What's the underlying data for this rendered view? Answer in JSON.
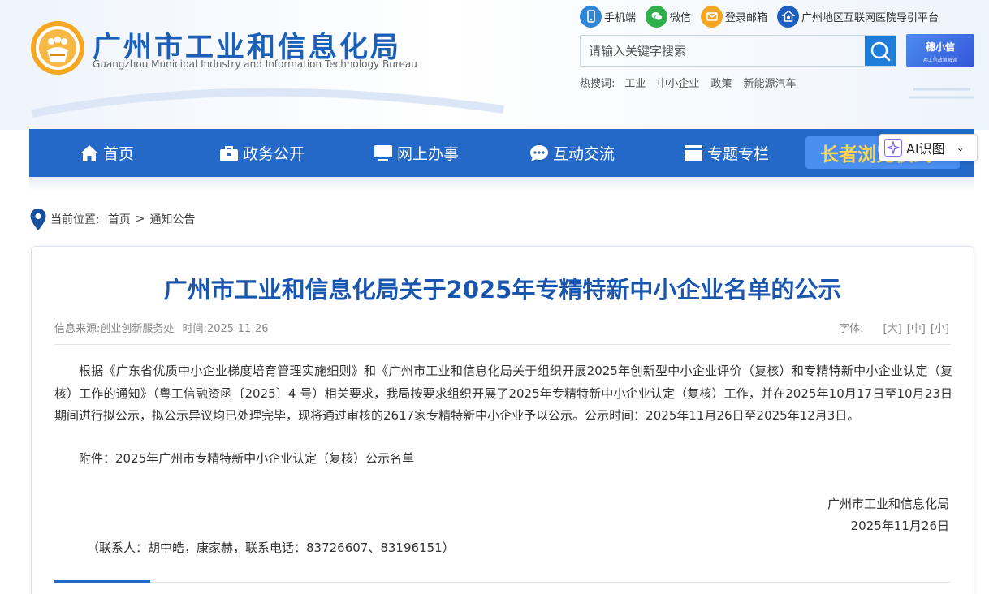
{
  "header": {
    "site_name_cn": "广州市工业和信息化局",
    "site_name_en": "Guangzhou Municipal Industry and Information Technology Bureau",
    "top_links": [
      {
        "label": "手机端",
        "icon": "mobile-icon"
      },
      {
        "label": "微信",
        "icon": "wechat-icon"
      },
      {
        "label": "登录邮箱",
        "icon": "mail-icon"
      },
      {
        "label": "广州地区互联网医院导引平台",
        "icon": "hospital-icon"
      }
    ],
    "search_placeholder": "请输入关键字搜索",
    "ai_banner_title": "穗小信",
    "ai_banner_sub": "AI工信政策解读",
    "hot_label": "热搜词:",
    "hot_words": [
      "工业",
      "中小企业",
      "政策",
      "新能源汽车"
    ],
    "brand_color": "#2468c8"
  },
  "nav": {
    "items": [
      {
        "label": "首页",
        "icon": "home-icon"
      },
      {
        "label": "政务公开",
        "icon": "briefcase-icon"
      },
      {
        "label": "网上办事",
        "icon": "monitor-icon"
      },
      {
        "label": "互动交流",
        "icon": "chat-icon"
      },
      {
        "label": "专题专栏",
        "icon": "folder-icon"
      }
    ],
    "elderly_label": "长者浏览模式"
  },
  "ai_widget": {
    "label": "AI识图",
    "icon": "sparkle-icon"
  },
  "breadcrumb": {
    "label": "当前位置:",
    "items": [
      "首页",
      "通知公告"
    ],
    "separator": ">"
  },
  "article": {
    "title": "广州市工业和信息化局关于2025年专精特新中小企业名单的公示",
    "source_label": "信息来源:",
    "source": "创业创新服务处",
    "time_label": "时间:",
    "time": "2025-11-26",
    "font_label": "字体:",
    "font_options": [
      "[大]",
      "[中]",
      "[小]"
    ],
    "body": "根据《广东省优质中小企业梯度培育管理实施细则》和《广州市工业和信息化局关于组织开展2025年创新型中小企业评价（复核）和专精特新中小企业认定（复核）工作的通知》（粤工信融资函〔2025〕4 号）相关要求，我局按要求组织开展了2025年专精特新中小企业认定（复核）工作，并在2025年10月17日至10月23日期间进行拟公示，拟公示异议均已处理完毕，现将通过审核的2617家专精特新中小企业予以公示。公示时间：2025年11月26日至2025年12月3日。",
    "attachment": "附件：2025年广州市专精特新中小企业认定（复核）公示名单",
    "sign_org": "广州市工业和信息化局",
    "sign_date": "2025年11月26日",
    "contact": "（联系人：胡中皓，康家赫，联系电话：83726607、83196151）"
  }
}
